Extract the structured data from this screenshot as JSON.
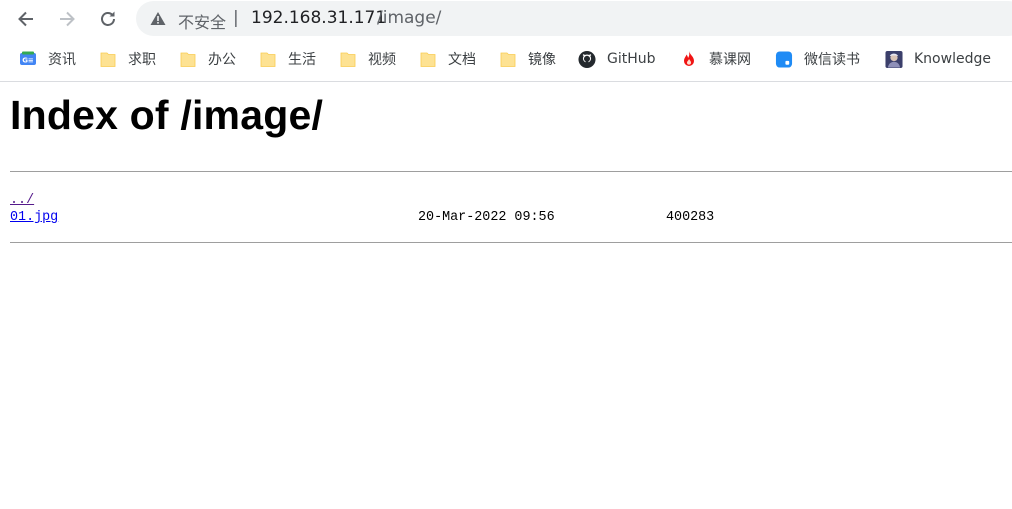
{
  "browser": {
    "security_label": "不安全",
    "url_separator": "|",
    "url_host": "192.168.31.171",
    "url_path": "/image/"
  },
  "bookmarks": [
    {
      "label": "资讯",
      "icon": "google-news-icon"
    },
    {
      "label": "求职",
      "icon": "folder-icon"
    },
    {
      "label": "办公",
      "icon": "folder-icon"
    },
    {
      "label": "生活",
      "icon": "folder-icon"
    },
    {
      "label": "视频",
      "icon": "folder-icon"
    },
    {
      "label": "文档",
      "icon": "folder-icon"
    },
    {
      "label": "镜像",
      "icon": "folder-icon"
    },
    {
      "label": "GitHub",
      "icon": "github-icon"
    },
    {
      "label": "慕课网",
      "icon": "flame-icon"
    },
    {
      "label": "微信读书",
      "icon": "weread-icon"
    },
    {
      "label": "Knowledge",
      "icon": "knowledge-avatar-icon"
    }
  ],
  "page": {
    "title": "Index of /image/",
    "entries": [
      {
        "name": "../",
        "date": "",
        "size": ""
      },
      {
        "name": "01.jpg",
        "date": "20-Mar-2022 09:56",
        "size": "400283"
      }
    ]
  },
  "colors": {
    "folder": "#fde293",
    "link": "#0000ee",
    "visited_link": "#551a8b",
    "omnibox_bg": "#f1f3f4"
  }
}
